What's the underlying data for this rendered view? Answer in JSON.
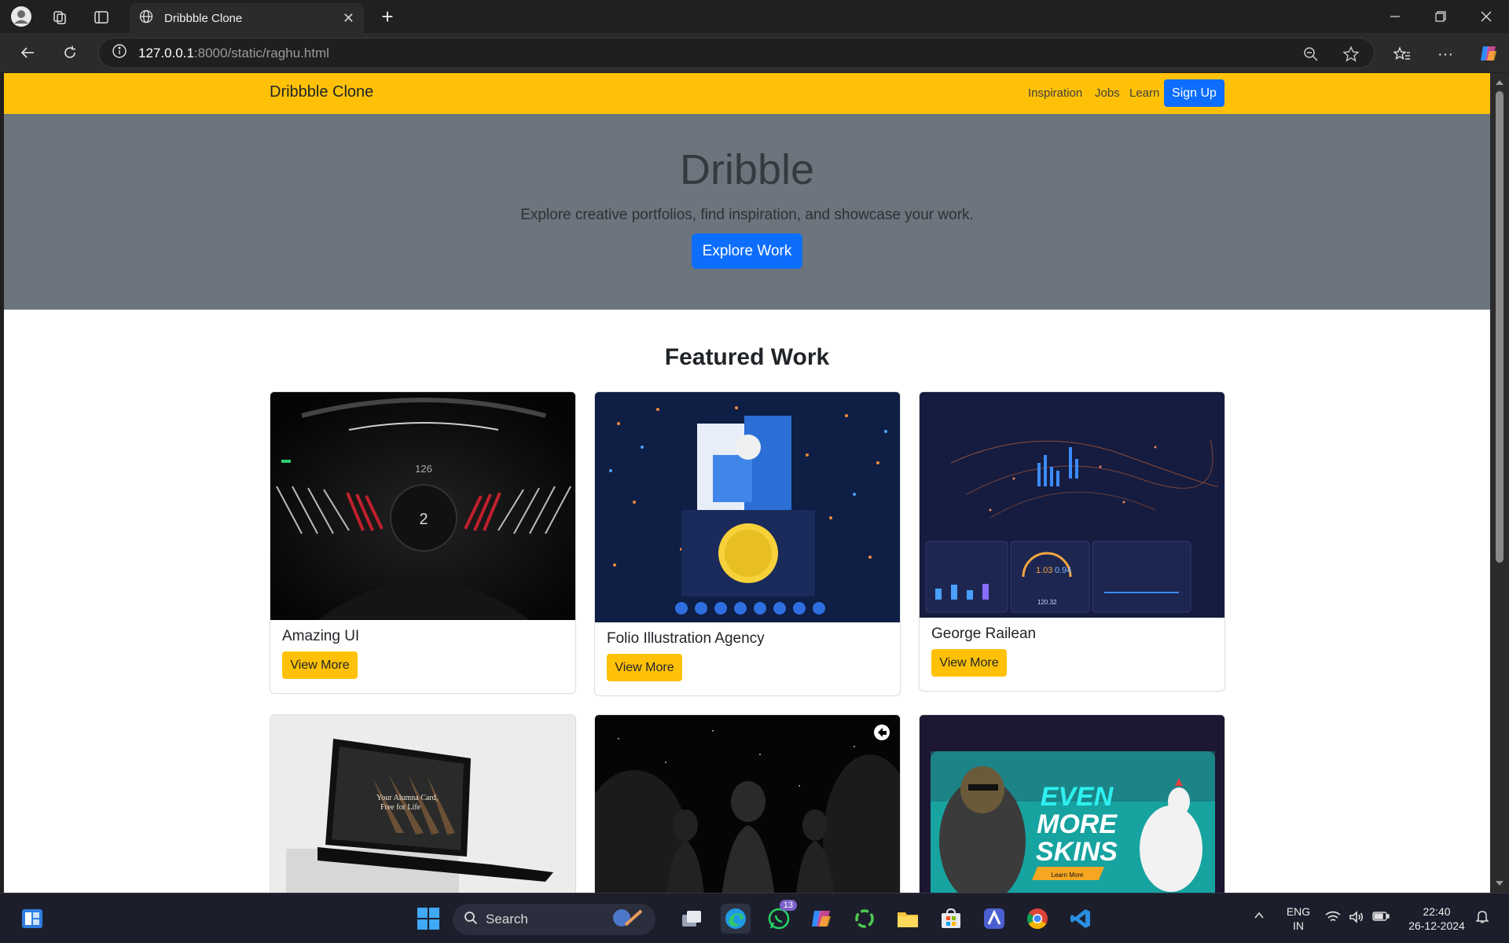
{
  "browser": {
    "tab_title": "Dribbble Clone",
    "url_host": "127.0.0.1",
    "url_rest": ":8000/static/raghu.html"
  },
  "site": {
    "brand": "Dribbble Clone",
    "nav": [
      "Inspiration",
      "Jobs",
      "Learn"
    ],
    "signup": "Sign Up"
  },
  "hero": {
    "title": "Dribble",
    "subtitle": "Explore creative portfolios, find inspiration, and showcase your work.",
    "cta": "Explore Work"
  },
  "featured": {
    "title": "Featured Work",
    "cards": [
      {
        "title": "Amazing UI",
        "button": "View More"
      },
      {
        "title": "Folio Illustration Agency",
        "button": "View More"
      },
      {
        "title": "George Railean",
        "button": "View More"
      }
    ],
    "thumb_texts": {
      "dash_speed": "126",
      "dash_gear": "2",
      "stat_a": "1.03",
      "stat_b": "0.94",
      "stat_c": "120.32",
      "laptop_line1": "Your Alumna Card,",
      "laptop_line2": "Free for Life",
      "game_line1": "EVEN",
      "game_line2": "MORE",
      "game_line3": "SKINS",
      "game_button": "Learn More"
    }
  },
  "taskbar": {
    "search_label": "Search",
    "whatsapp_badge": "13",
    "lang_line1": "ENG",
    "lang_line2": "IN",
    "time": "22:40",
    "date": "26-12-2024"
  },
  "colors": {
    "navbar": "#ffc107",
    "hero": "#6c757d",
    "primary": "#0d6efd"
  }
}
